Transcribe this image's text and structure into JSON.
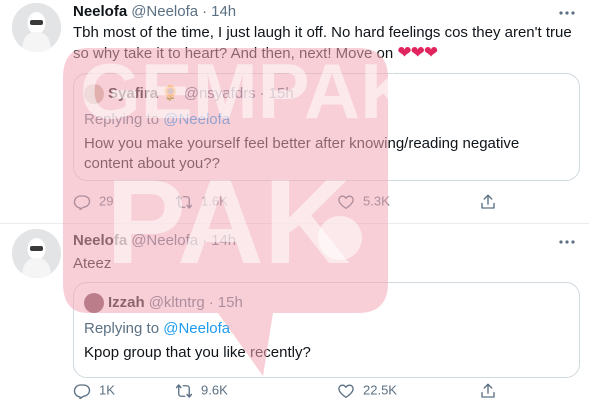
{
  "colors": {
    "text_primary": "#0f1419",
    "text_secondary": "#5b7083",
    "link": "#1d9bf0",
    "heart": "#e0245e",
    "divider": "#e6ecf0",
    "watermark_fill": "#f3a7b4",
    "watermark_text": "#ffffff"
  },
  "watermark": {
    "line1": "GEMPAK",
    "line2": "PAK"
  },
  "tweets": [
    {
      "author_name": "Neelofa",
      "author_handle": "@Neelofa",
      "separator": "·",
      "time": "14h",
      "more_icon": "more-dots-icon",
      "text": "Tbh most of the time, I just laugh it off. No hard feelings cos they aren't true so why take it to heart? And then, next! Move on",
      "text_emoji": "❤❤❤",
      "quote": {
        "author_name": "Syafira",
        "author_emoji": "🌻",
        "author_handle": "@nsyafdrs",
        "separator": "·",
        "time": "15h",
        "replying_prefix": "Replying to",
        "replying_to": "@Neelofa",
        "text": "How you make yourself feel better after knowing/reading negative content about you??"
      },
      "actions": {
        "reply_count": "29",
        "retweet_count": "1.6K",
        "like_count": "5.3K"
      }
    },
    {
      "author_name": "Neelofa",
      "author_handle": "@Neelofa",
      "separator": "·",
      "time": "14h",
      "more_icon": "more-dots-icon",
      "text": "Ateez",
      "quote": {
        "author_name": "Izzah",
        "author_handle": "@kltntrg",
        "separator": "·",
        "time": "15h",
        "replying_prefix": "Replying to",
        "replying_to": "@Neelofa",
        "text": "Kpop group that you like recently?"
      },
      "actions": {
        "reply_count": "1K",
        "retweet_count": "9.6K",
        "like_count": "22.5K"
      }
    }
  ]
}
